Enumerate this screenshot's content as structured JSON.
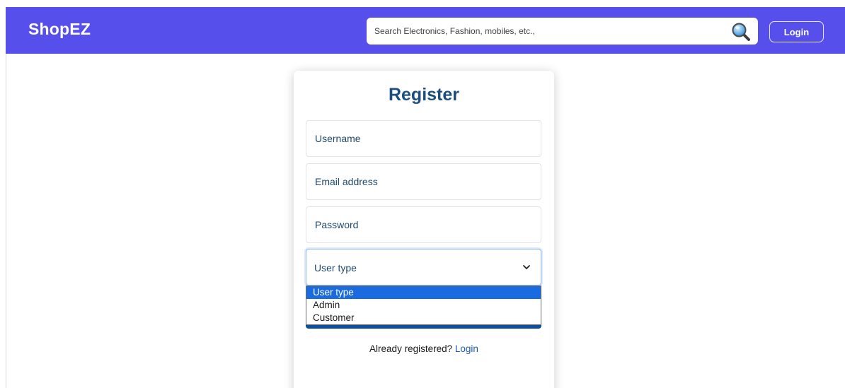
{
  "navbar": {
    "brand": "ShopEZ",
    "search": {
      "placeholder": "Search Electronics, Fashion, mobiles, etc.,",
      "value": ""
    },
    "login_label": "Login"
  },
  "register": {
    "title": "Register",
    "username_placeholder": "Username",
    "email_placeholder": "Email address",
    "password_placeholder": "Password",
    "user_type": {
      "selected": "User type",
      "options": [
        "User type",
        "Admin",
        "Customer"
      ]
    },
    "footer_text": "Already registered?",
    "footer_link": "Login"
  },
  "colors": {
    "navbar_bg": "#574fec",
    "title": "#1c4f7f",
    "option_highlight": "#1a6be0",
    "link": "#1a5aa8"
  }
}
